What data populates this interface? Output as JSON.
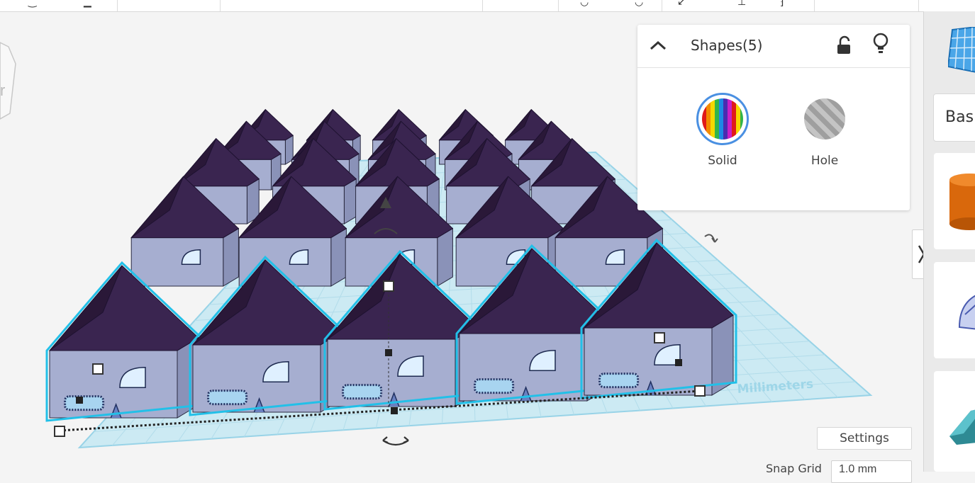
{
  "app": {
    "accent": "#22c0e8",
    "roof_color": "#3a2550",
    "wall_color": "#a6aed0"
  },
  "workplane": {
    "units_label": "Millimeters",
    "house_rows": 5,
    "house_cols": 5
  },
  "inspector": {
    "title": "Shapes(5)",
    "collapse_icon": "chevron-up-icon",
    "lock_icon": "unlock-icon",
    "light_icon": "lightbulb-icon",
    "options": [
      {
        "label": "Solid",
        "selected": true,
        "icon": "rainbow-stripes"
      },
      {
        "label": "Hole",
        "selected": false,
        "icon": "gray-stripes"
      }
    ]
  },
  "sidebar": {
    "category_label": "Basi",
    "grid_icon": "workplane-grid-icon"
  },
  "bottom": {
    "settings_label": "Settings",
    "snap_grid_label": "Snap Grid",
    "snap_grid_value": "1.0 mm"
  }
}
